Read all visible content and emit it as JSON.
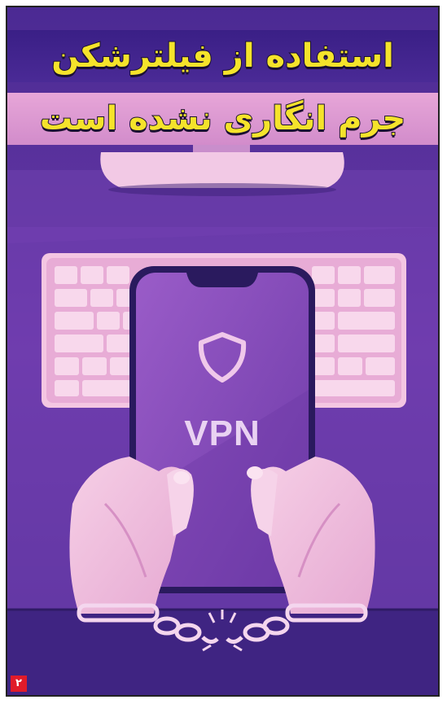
{
  "headline": {
    "line1": "استفاده از فیلترشکن",
    "line2": "جرم انگاری نشده است"
  },
  "illustration": {
    "screen_text": "VPN",
    "icons": [
      "shield-icon",
      "broken-chain-icon"
    ]
  },
  "page_number": "۲",
  "colors": {
    "background": "#5a2f9a",
    "headline_text": "#f5e32b",
    "banner_dark": "#3a1f86",
    "banner_pink": "#e7a6d8",
    "badge": "#e11b2a"
  }
}
